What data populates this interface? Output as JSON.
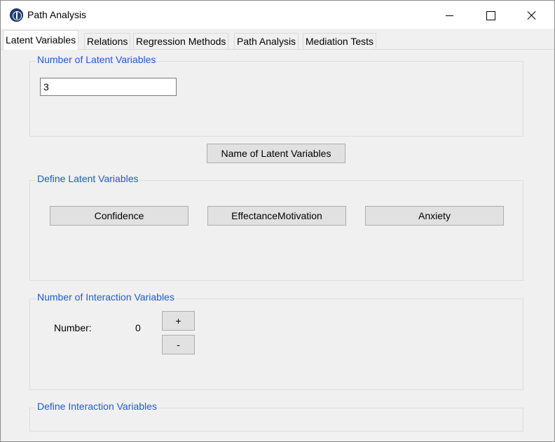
{
  "window": {
    "title": "Path Analysis"
  },
  "tabs": [
    {
      "label": "Latent Variables",
      "active": true
    },
    {
      "label": "Relations"
    },
    {
      "label": "Regression Methods"
    },
    {
      "label": "Path Analysis"
    },
    {
      "label": "Mediation Tests"
    }
  ],
  "latent_count": {
    "legend": "Number of Latent Variables",
    "value": "3"
  },
  "name_button_label": "Name of Latent Variables",
  "define_latent": {
    "legend": "Define Latent Variables",
    "variables": [
      "Confidence",
      "EffectanceMotivation",
      "Anxiety"
    ]
  },
  "interaction_count": {
    "legend": "Number of Interaction Variables",
    "number_label": "Number:",
    "number_value": "0",
    "plus_label": "+",
    "minus_label": "-"
  },
  "define_interaction": {
    "legend": "Define Interaction Variables"
  },
  "colors": {
    "legend_blue": "#1d5bd6",
    "panel_bg": "#f0f0f0",
    "button_bg": "#e1e1e1"
  }
}
